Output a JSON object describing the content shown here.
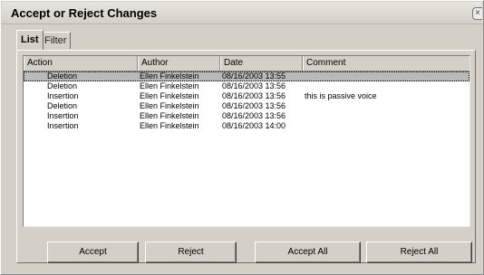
{
  "window": {
    "title": "Accept or Reject Changes",
    "close_symbol": "×"
  },
  "tabs": [
    {
      "label": "List",
      "active": true
    },
    {
      "label": "Filter",
      "active": false
    }
  ],
  "list": {
    "columns": [
      "Action",
      "Author",
      "Date",
      "Comment"
    ],
    "rows": [
      {
        "action": "Deletion",
        "author": "Ellen Finkelstein",
        "date": "08/16/2003 13:55",
        "comment": "",
        "selected": true
      },
      {
        "action": "Deletion",
        "author": "Ellen Finkelstein",
        "date": "08/16/2003 13:56",
        "comment": ""
      },
      {
        "action": "Insertion",
        "author": "Ellen Finkelstein",
        "date": "08/16/2003 13:56",
        "comment": "this is passive voice"
      },
      {
        "action": "Deletion",
        "author": "Ellen Finkelstein",
        "date": "08/16/2003 13:56",
        "comment": ""
      },
      {
        "action": "Insertion",
        "author": "Ellen Finkelstein",
        "date": "08/16/2003 13:56",
        "comment": ""
      },
      {
        "action": "Insertion",
        "author": "Ellen Finkelstein",
        "date": "08/16/2003 14:00",
        "comment": ""
      }
    ]
  },
  "buttons": {
    "accept": "Accept",
    "reject": "Reject",
    "accept_all": "Accept All",
    "reject_all": "Reject All"
  }
}
